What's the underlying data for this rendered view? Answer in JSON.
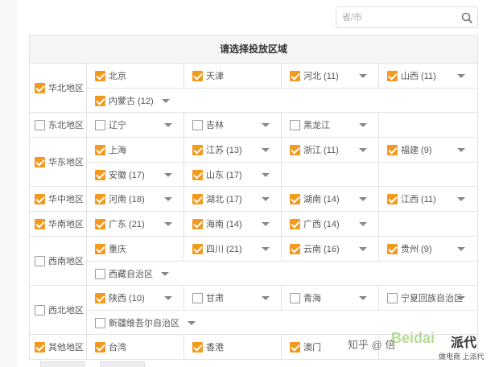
{
  "search": {
    "placeholder": "省/市"
  },
  "table": {
    "header": "请选择投放区域",
    "regions": [
      {
        "name": "华北地区",
        "checked": true,
        "lines": [
          [
            {
              "name": "北京",
              "checked": true,
              "caret": false
            },
            {
              "name": "天津",
              "checked": true,
              "caret": false
            },
            {
              "name": "河北 (11)",
              "checked": true,
              "caret": true
            },
            {
              "name": "山西 (11)",
              "checked": true,
              "caret": true
            }
          ],
          [
            {
              "name": "内蒙古 (12)",
              "checked": true,
              "caret": true,
              "wide": true
            }
          ]
        ]
      },
      {
        "name": "东北地区",
        "checked": false,
        "lines": [
          [
            {
              "name": "辽宁",
              "checked": false,
              "caret": true
            },
            {
              "name": "吉林",
              "checked": false,
              "caret": true
            },
            {
              "name": "黑龙江",
              "checked": false,
              "caret": true
            },
            null
          ]
        ]
      },
      {
        "name": "华东地区",
        "checked": true,
        "lines": [
          [
            {
              "name": "上海",
              "checked": true,
              "caret": false
            },
            {
              "name": "江苏 (13)",
              "checked": true,
              "caret": true
            },
            {
              "name": "浙江 (11)",
              "checked": true,
              "caret": true
            },
            {
              "name": "福建 (9)",
              "checked": true,
              "caret": true
            }
          ],
          [
            {
              "name": "安徽 (17)",
              "checked": true,
              "caret": true
            },
            {
              "name": "山东 (17)",
              "checked": true,
              "caret": true
            },
            null,
            null
          ]
        ]
      },
      {
        "name": "华中地区",
        "checked": true,
        "lines": [
          [
            {
              "name": "河南 (18)",
              "checked": true,
              "caret": true
            },
            {
              "name": "湖北 (17)",
              "checked": true,
              "caret": true
            },
            {
              "name": "湖南 (14)",
              "checked": true,
              "caret": true
            },
            {
              "name": "江西 (11)",
              "checked": true,
              "caret": true
            }
          ]
        ]
      },
      {
        "name": "华南地区",
        "checked": true,
        "lines": [
          [
            {
              "name": "广东 (21)",
              "checked": true,
              "caret": true
            },
            {
              "name": "海南 (14)",
              "checked": true,
              "caret": true
            },
            {
              "name": "广西 (14)",
              "checked": true,
              "caret": true
            },
            null
          ]
        ]
      },
      {
        "name": "西南地区",
        "checked": false,
        "lines": [
          [
            {
              "name": "重庆",
              "checked": true,
              "caret": false
            },
            {
              "name": "四川 (21)",
              "checked": true,
              "caret": true
            },
            {
              "name": "云南 (16)",
              "checked": true,
              "caret": true
            },
            {
              "name": "贵州 (9)",
              "checked": true,
              "caret": true
            }
          ],
          [
            {
              "name": "西藏自治区",
              "checked": false,
              "caret": true,
              "wide": true
            }
          ]
        ]
      },
      {
        "name": "西北地区",
        "checked": false,
        "lines": [
          [
            {
              "name": "陕西 (10)",
              "checked": true,
              "caret": true
            },
            {
              "name": "甘肃",
              "checked": false,
              "caret": true
            },
            {
              "name": "青海",
              "checked": false,
              "caret": true
            },
            {
              "name": "宁夏回族自治区",
              "checked": false,
              "caret": true
            }
          ],
          [
            {
              "name": "新疆维吾尔自治区",
              "checked": false,
              "caret": true,
              "wide": true
            }
          ]
        ]
      },
      {
        "name": "其他地区",
        "checked": true,
        "lines": [
          [
            {
              "name": "台湾",
              "checked": true,
              "caret": false
            },
            {
              "name": "香港",
              "checked": true,
              "caret": false
            },
            {
              "name": "澳门",
              "checked": true,
              "caret": false
            },
            null
          ]
        ]
      }
    ]
  },
  "watermark": {
    "zh": "知乎 @ 倍",
    "latin": "Beidai",
    "brand": "派代",
    "sub": "做电商 上派代"
  },
  "colors": {
    "accent": "#f39a1e",
    "border": "#e2e2e2",
    "header_bg": "#f5f5f5"
  }
}
